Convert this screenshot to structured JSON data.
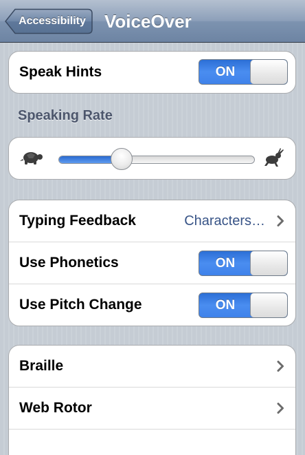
{
  "navbar": {
    "back_label": "Accessibility",
    "title": "VoiceOver"
  },
  "speak_hints": {
    "label": "Speak Hints",
    "state": "ON"
  },
  "speaking_rate": {
    "header": "Speaking Rate",
    "value_fraction": 0.32,
    "slow_icon": "turtle-icon",
    "fast_icon": "hare-icon"
  },
  "typing_group": {
    "typing_feedback": {
      "label": "Typing Feedback",
      "value": "Characters…"
    },
    "use_phonetics": {
      "label": "Use Phonetics",
      "state": "ON"
    },
    "use_pitch_change": {
      "label": "Use Pitch Change",
      "state": "ON"
    }
  },
  "nav_group": {
    "items": [
      {
        "label": "Braille"
      },
      {
        "label": "Web Rotor"
      }
    ]
  },
  "colors": {
    "toggle_on": "#3f82ea",
    "detail_text": "#385487",
    "section_header": "#4c566c"
  }
}
